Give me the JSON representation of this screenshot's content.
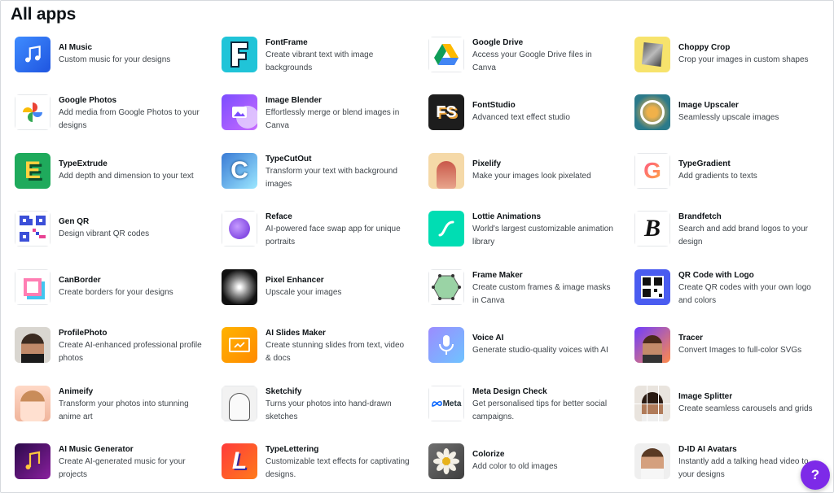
{
  "page_title": "All apps",
  "help_label": "?",
  "colors": {
    "accent": "#7d2ae8",
    "text": "#0d1216",
    "muted": "#3f454b"
  },
  "apps": [
    {
      "name": "AI Music",
      "desc": "Custom music for your designs",
      "icon": "music-note-icon"
    },
    {
      "name": "FontFrame",
      "desc": "Create vibrant text with image backgrounds",
      "icon": "fontframe-f-icon"
    },
    {
      "name": "Google Drive",
      "desc": "Access your Google Drive files in Canva",
      "icon": "google-drive-icon"
    },
    {
      "name": "Choppy Crop",
      "desc": "Crop your images in custom shapes",
      "icon": "choppy-crop-icon"
    },
    {
      "name": "Google Photos",
      "desc": "Add media from Google Photos to your designs",
      "icon": "google-photos-icon"
    },
    {
      "name": "Image Blender",
      "desc": "Effortlessly merge or blend images in Canva",
      "icon": "image-blender-icon"
    },
    {
      "name": "FontStudio",
      "desc": "Advanced text effect studio",
      "icon": "fontstudio-fs-icon"
    },
    {
      "name": "Image Upscaler",
      "desc": "Seamlessly upscale images",
      "icon": "image-upscaler-icon"
    },
    {
      "name": "TypeExtrude",
      "desc": "Add depth and dimension to your text",
      "icon": "typeextrude-e-icon"
    },
    {
      "name": "TypeCutOut",
      "desc": "Transform your text with background images",
      "icon": "typecutout-c-icon"
    },
    {
      "name": "Pixelify",
      "desc": "Make your images look pixelated",
      "icon": "pixelify-portrait-icon"
    },
    {
      "name": "TypeGradient",
      "desc": "Add gradients to texts",
      "icon": "typegradient-g-icon"
    },
    {
      "name": "Gen QR",
      "desc": "Design vibrant QR codes",
      "icon": "qr-code-icon"
    },
    {
      "name": "Reface",
      "desc": "AI-powered face swap app for unique portraits",
      "icon": "reface-icon"
    },
    {
      "name": "Lottie Animations",
      "desc": "World's largest customizable animation library",
      "icon": "lottie-icon"
    },
    {
      "name": "Brandfetch",
      "desc": "Search and add brand logos to your design",
      "icon": "brandfetch-b-icon"
    },
    {
      "name": "CanBorder",
      "desc": "Create borders for your designs",
      "icon": "canborder-icon"
    },
    {
      "name": "Pixel Enhancer",
      "desc": "Upscale your images",
      "icon": "pixel-enhancer-icon"
    },
    {
      "name": "Frame Maker",
      "desc": "Create custom frames & image masks in Canva",
      "icon": "frame-maker-icon"
    },
    {
      "name": "QR Code with Logo",
      "desc": "Create QR codes with your own logo and colors",
      "icon": "qr-logo-icon"
    },
    {
      "name": "ProfilePhoto",
      "desc": "Create AI-enhanced professional profile photos",
      "icon": "profile-photo-icon"
    },
    {
      "name": "AI Slides Maker",
      "desc": "Create stunning slides from text, video & docs",
      "icon": "slides-icon"
    },
    {
      "name": "Voice AI",
      "desc": "Generate studio-quality voices with AI",
      "icon": "microphone-icon"
    },
    {
      "name": "Tracer",
      "desc": "Convert Images to full-color SVGs",
      "icon": "tracer-icon"
    },
    {
      "name": "Animeify",
      "desc": "Transform your photos into stunning anime art",
      "icon": "animeify-icon"
    },
    {
      "name": "Sketchify",
      "desc": "Turns your photos into hand-drawn sketches",
      "icon": "sketchify-icon"
    },
    {
      "name": "Meta Design Check",
      "desc": "Get personalised tips for better social campaigns.",
      "icon": "meta-logo-icon",
      "logo_text": "Meta"
    },
    {
      "name": "Image Splitter",
      "desc": "Create seamless carousels and grids",
      "icon": "image-splitter-icon"
    },
    {
      "name": "AI Music Generator",
      "desc": "Create AI-generated music for your projects",
      "icon": "music-generator-icon"
    },
    {
      "name": "TypeLettering",
      "desc": "Customizable text effects for captivating designs.",
      "icon": "typelettering-l-icon"
    },
    {
      "name": "Colorize",
      "desc": "Add color to old images",
      "icon": "colorize-flower-icon"
    },
    {
      "name": "D-ID AI Avatars",
      "desc": "Instantly add a talking head video to your designs",
      "icon": "did-avatar-icon"
    }
  ]
}
